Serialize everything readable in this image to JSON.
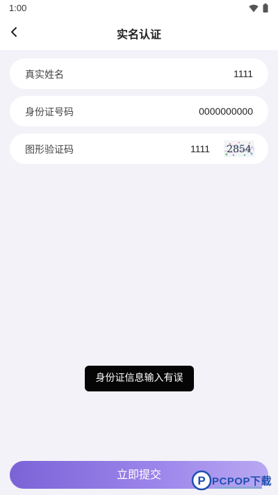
{
  "status_bar": {
    "time": "1:00",
    "icons": [
      "wifi-icon",
      "battery-icon"
    ]
  },
  "header": {
    "title": "实名认证",
    "back_icon": "chevron-left-icon"
  },
  "form": {
    "name": {
      "label": "真实姓名",
      "value": "1111"
    },
    "id_number": {
      "label": "身份证号码",
      "value": "0000000000"
    },
    "captcha": {
      "label": "图形验证码",
      "value": "1111",
      "image_text": "2854"
    }
  },
  "toast": {
    "message": "身份证信息输入有误"
  },
  "submit": {
    "label": "立即提交"
  },
  "watermark": {
    "text": "PCPOP下载",
    "badge_letter": "P"
  },
  "colors": {
    "page_background": "#f3f2f8",
    "card_background": "#ffffff",
    "accent_start": "#7b63d6",
    "accent_end": "#b9a8f2",
    "toast_background": "#050505"
  }
}
